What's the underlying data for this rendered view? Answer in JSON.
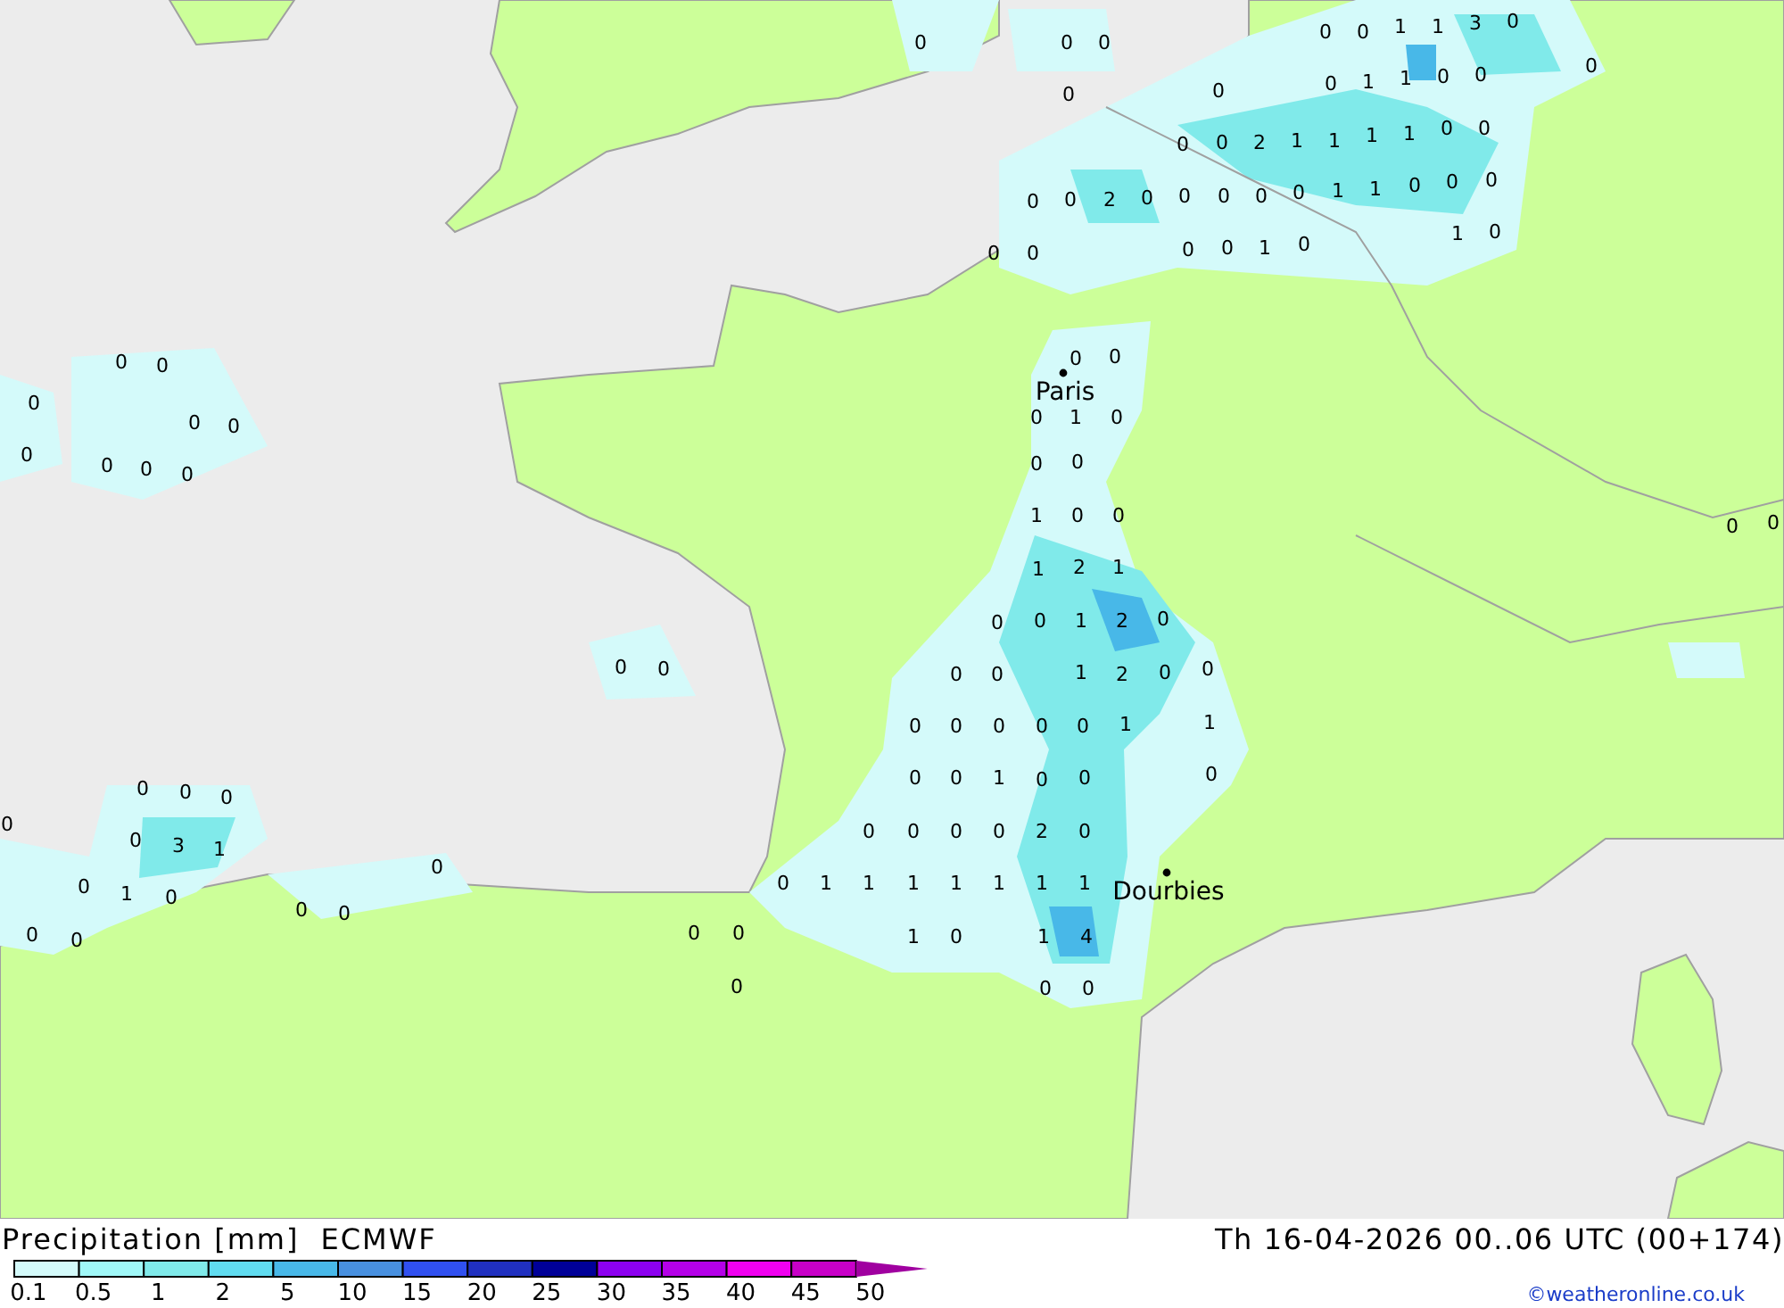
{
  "map": {
    "values": [
      "0",
      "0",
      "0",
      "0",
      "0",
      "0",
      "1",
      "1",
      "3",
      "0",
      "0",
      "0",
      "0",
      "1",
      "1",
      "0",
      "0",
      "0",
      "0",
      "2",
      "1",
      "1",
      "1",
      "1",
      "0",
      "0",
      "0",
      "0",
      "2",
      "0",
      "0",
      "0",
      "0",
      "0",
      "1",
      "1",
      "0",
      "0",
      "0",
      "0",
      "0",
      "0",
      "0",
      "1",
      "0",
      "1",
      "0",
      "0",
      "0",
      "0",
      "0",
      "0",
      "0",
      "0",
      "0",
      "0",
      "0",
      "0",
      "0",
      "1",
      "0",
      "0",
      "0",
      "1",
      "0",
      "0",
      "1",
      "2",
      "1",
      "0",
      "0",
      "1",
      "2",
      "0",
      "0",
      "0",
      "0",
      "0",
      "1",
      "2",
      "0",
      "0",
      "0",
      "0",
      "0",
      "0",
      "0",
      "1",
      "1",
      "0",
      "0",
      "1",
      "0",
      "0",
      "0",
      "0",
      "0",
      "0",
      "0",
      "2",
      "0",
      "0",
      "1",
      "1",
      "1",
      "1",
      "1",
      "1",
      "1",
      "0",
      "0",
      "1",
      "0",
      "1",
      "4",
      "0",
      "0",
      "0",
      "0",
      "0",
      "0",
      "0",
      "0",
      "3",
      "1",
      "0",
      "1",
      "0",
      "0",
      "0",
      "0",
      "0",
      "0",
      "0",
      "0"
    ],
    "cities": [
      {
        "name": "Paris"
      },
      {
        "name": "Dourbies"
      }
    ]
  },
  "footer": {
    "title": "Precipitation [mm]",
    "model": "ECMWF",
    "valid_time": "Th 16-04-2026 00..06 UTC (00+174)",
    "credit": "©weatheronline.co.uk"
  },
  "legend": {
    "labels": [
      "0.1",
      "0.5",
      "1",
      "2",
      "5",
      "10",
      "15",
      "20",
      "25",
      "30",
      "35",
      "40",
      "45",
      "50"
    ],
    "bins": [
      {
        "color": "#d4fafa"
      },
      {
        "color": "#a0f8f8"
      },
      {
        "color": "#80eaea"
      },
      {
        "color": "#60dcf0"
      },
      {
        "color": "#48b8e8"
      },
      {
        "color": "#4890e0"
      },
      {
        "color": "#3050f0"
      },
      {
        "color": "#2030c0"
      },
      {
        "color": "#000098"
      },
      {
        "color": "#8c00f0"
      },
      {
        "color": "#b400e8"
      },
      {
        "color": "#f000f0"
      },
      {
        "color": "#c800c8"
      }
    ]
  }
}
